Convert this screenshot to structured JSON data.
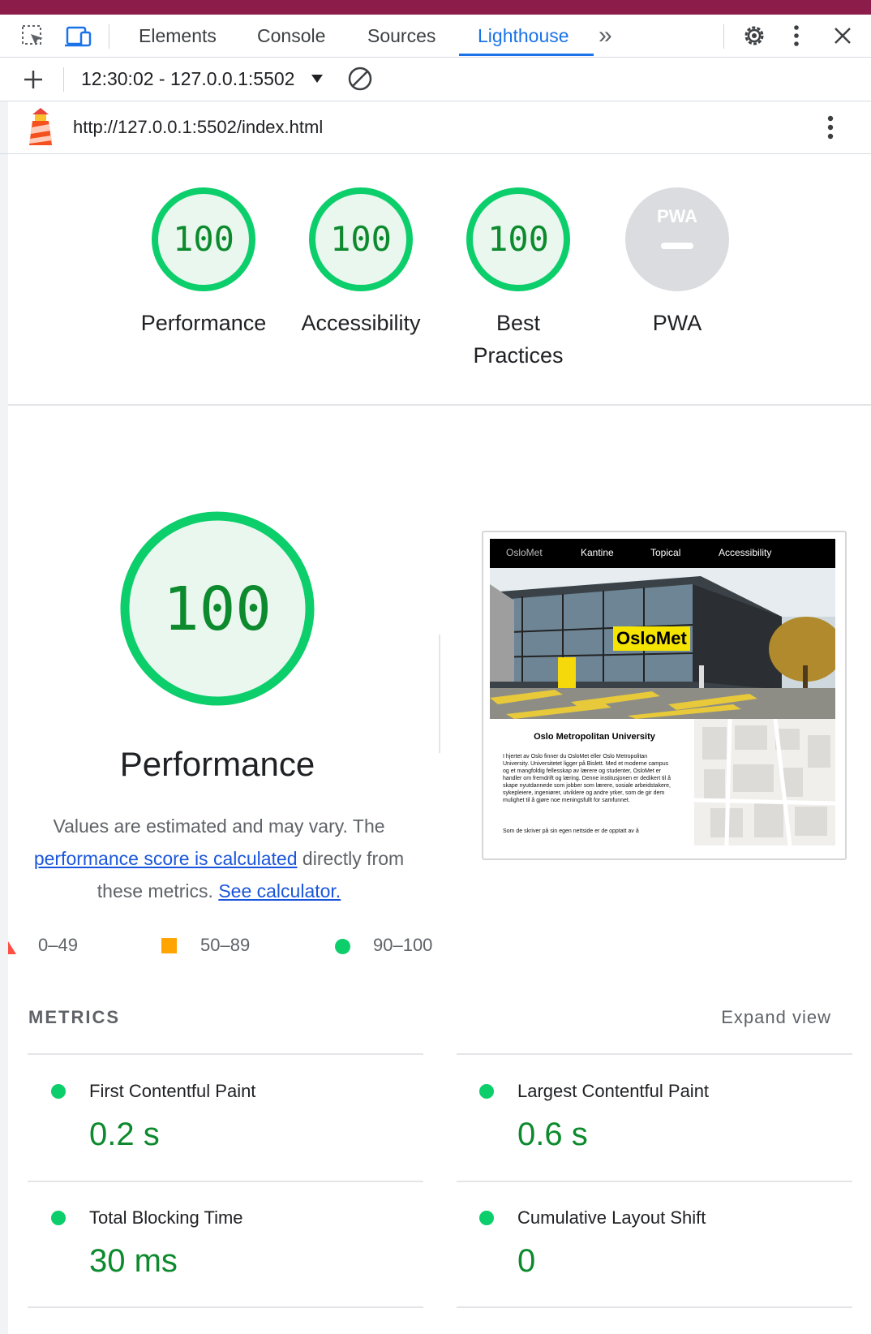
{
  "devtools": {
    "tabs": [
      "Elements",
      "Console",
      "Sources",
      "Lighthouse"
    ],
    "active_tab": "Lighthouse",
    "more_tabs_glyph": "»",
    "session": "12:30:02 - 127.0.0.1:5502",
    "url": "http://127.0.0.1:5502/index.html"
  },
  "colors": {
    "pass": "#0cce6b",
    "pass_text": "#0c8a2d",
    "average": "#ffa400",
    "fail": "#ff4e42",
    "link": "#1a56db",
    "accent": "#1a73e8"
  },
  "categories": [
    {
      "score": "100",
      "label": "Performance"
    },
    {
      "score": "100",
      "label": "Accessibility"
    },
    {
      "score": "100",
      "label": "Best Practices"
    },
    {
      "score": "",
      "badge": "PWA",
      "label": "PWA"
    }
  ],
  "performance": {
    "score": "100",
    "title": "Performance",
    "desc_1": "Values are estimated and may vary. The",
    "desc_link": "performance score is calculated",
    "desc_2": "directly from",
    "desc_3": "these metrics.",
    "calc_link": "See calculator."
  },
  "legend": [
    "0–49",
    "50–89",
    "90–100"
  ],
  "metrics_header": "METRICS",
  "expand_view": "Expand view",
  "metrics": [
    {
      "name": "First Contentful Paint",
      "value": "0.2 s"
    },
    {
      "name": "Largest Contentful Paint",
      "value": "0.6 s"
    },
    {
      "name": "Total Blocking Time",
      "value": "30 ms"
    },
    {
      "name": "Cumulative Layout Shift",
      "value": "0"
    }
  ],
  "thumbnail": {
    "nav": [
      "OsloMet",
      "Kantine",
      "Topical",
      "Accessibility"
    ],
    "hero_sign": "OsloMet",
    "heading": "Oslo Metropolitan University",
    "body": "I hjertet av Oslo finner du OsloMet eller Oslo Metropolitan University. Universitetet ligger på Bislett. Med et moderne campus og et mangfoldig fellesskap av lærere og studenter, OsloMet er handler om fremdrift og læring. Denne institusjonen er dedikert til å skape nyutdannede som jobber som lærere, sosiale arbeidstakere, sykepleiere, ingeniører, utviklere og andre yrker, som de gir dem mulighet til å gjøre noe meningsfullt for samfunnet.",
    "tail": "Som de skriver på sin egen nettside er de opptatt av å"
  }
}
